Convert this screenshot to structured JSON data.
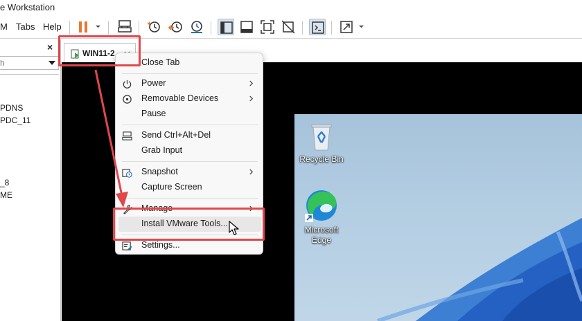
{
  "window": {
    "title": "e Workstation"
  },
  "menubar": {
    "items": [
      "M",
      "Tabs",
      "Help"
    ]
  },
  "toolbar": {
    "buttons": [
      "pause",
      "send-ctrl-alt-del",
      "snapshot",
      "revert-snapshot",
      "snapshot-manager",
      "show-library",
      "show-thumbnail-bar",
      "full-screen",
      "unity",
      "console-view",
      "stretch-guest"
    ]
  },
  "library": {
    "close_glyph": "×",
    "search_placeholder": "h",
    "tree": [
      "PDNS",
      "PDC_11",
      "_8",
      "ME"
    ]
  },
  "tab": {
    "label": "WIN11-2"
  },
  "context_menu": {
    "items": [
      {
        "label": "Close Tab",
        "icon": "none",
        "submenu": false
      },
      {
        "label": "Power",
        "icon": "power-icon",
        "submenu": true
      },
      {
        "label": "Removable Devices",
        "icon": "removable-devices-icon",
        "submenu": true
      },
      {
        "label": "Pause",
        "icon": "none",
        "submenu": false
      },
      {
        "label": "Send Ctrl+Alt+Del",
        "icon": "keyboard-icon",
        "submenu": false
      },
      {
        "label": "Grab Input",
        "icon": "none",
        "submenu": false
      },
      {
        "label": "Snapshot",
        "icon": "snapshot-icon",
        "submenu": true
      },
      {
        "label": "Capture Screen",
        "icon": "none",
        "submenu": false
      },
      {
        "label": "Manage",
        "icon": "wrench-icon",
        "submenu": true
      },
      {
        "label": "Install VMware Tools...",
        "icon": "none",
        "submenu": false,
        "highlighted": true
      },
      {
        "label": "Settings...",
        "icon": "settings-icon",
        "submenu": false
      }
    ]
  },
  "desktop": {
    "icons": [
      {
        "label": "Recycle Bin",
        "icon": "recycle-bin-icon"
      },
      {
        "label_line1": "Microsoft",
        "label_line2": "Edge",
        "icon": "edge-icon"
      }
    ]
  },
  "colors": {
    "annotation_red": "#e0474c",
    "accent_orange": "#e8772e",
    "menu_bg": "#f8f8f8"
  }
}
